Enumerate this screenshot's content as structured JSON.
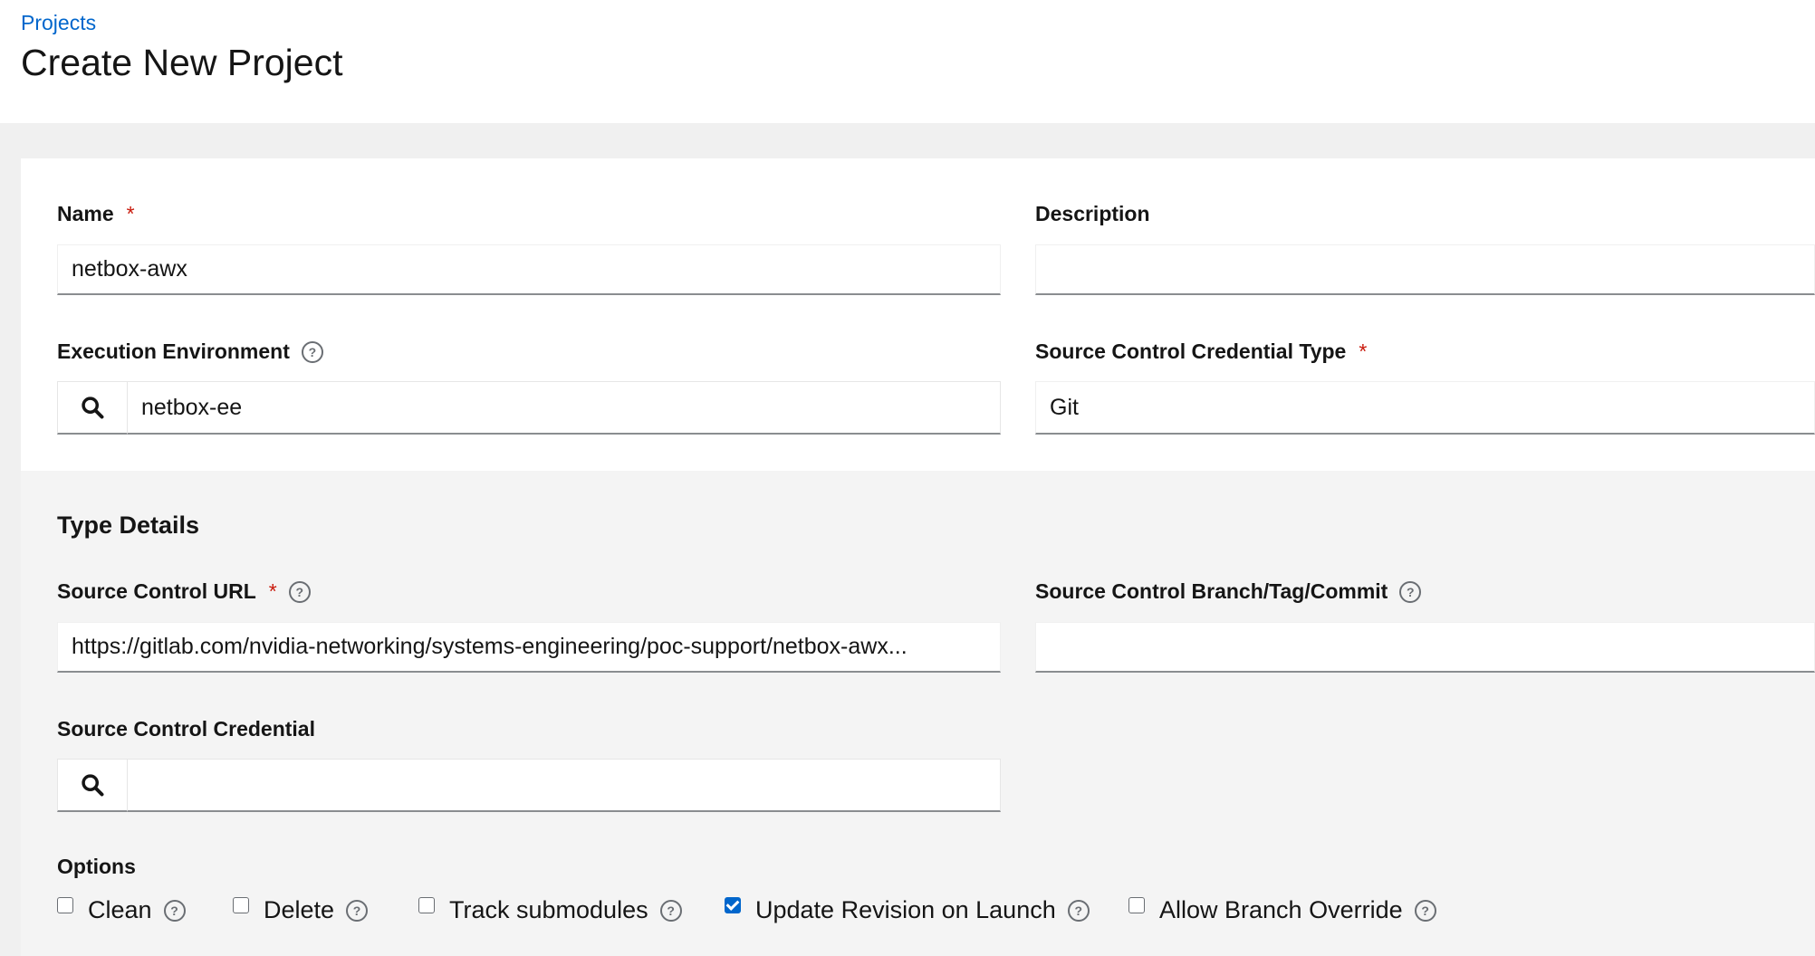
{
  "header": {
    "breadcrumb": "Projects",
    "title": "Create New Project"
  },
  "form": {
    "name": {
      "label": "Name",
      "required": "*",
      "value": "netbox-awx"
    },
    "description": {
      "label": "Description",
      "value": ""
    },
    "execution_environment": {
      "label": "Execution Environment",
      "value": "netbox-ee"
    },
    "scm_type": {
      "label": "Source Control Credential Type",
      "required": "*",
      "value": "Git"
    }
  },
  "type_details": {
    "title": "Type Details",
    "scm_url": {
      "label": "Source Control URL",
      "required": "*",
      "value": "https://gitlab.com/nvidia-networking/systems-engineering/poc-support/netbox-awx..."
    },
    "scm_branch": {
      "label": "Source Control Branch/Tag/Commit",
      "value": ""
    },
    "scm_credential": {
      "label": "Source Control Credential",
      "value": ""
    },
    "options_label": "Options",
    "options": [
      {
        "label": "Clean",
        "checked": false
      },
      {
        "label": "Delete",
        "checked": false
      },
      {
        "label": "Track submodules",
        "checked": false
      },
      {
        "label": "Update Revision on Launch",
        "checked": true
      },
      {
        "label": "Allow Branch Override",
        "checked": false
      }
    ]
  },
  "icons": {
    "help": "question-circle-icon",
    "search": "search-icon"
  },
  "colors": {
    "link": "#0066cc",
    "required": "#c9190b",
    "checkbox_checked": "#0066cc"
  }
}
